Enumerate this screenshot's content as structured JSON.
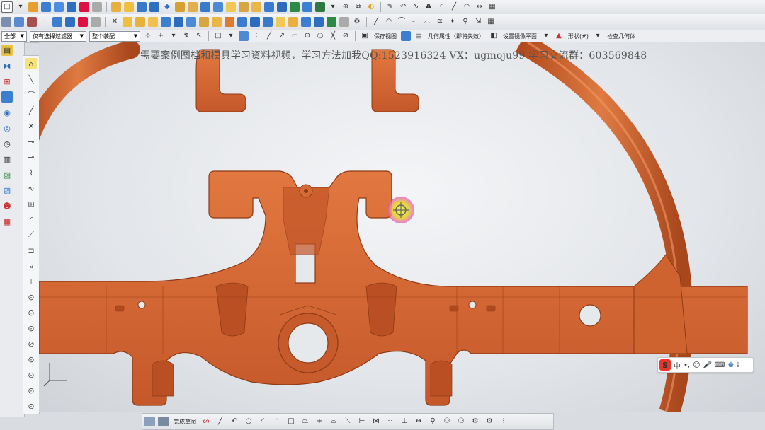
{
  "toolbar": {
    "row1_icons": [
      "new-file-icon",
      "shield-icon",
      "cube-icon",
      "box-icon",
      "document-icon",
      "cylinder-icon",
      "cone-icon",
      "surface-icon",
      "blend-icon",
      "sweep-icon",
      "trim-icon",
      "mesh-icon",
      "dimension-icon",
      "sheet-icon",
      "view-icon",
      "layer-icon",
      "palette-icon",
      "camera-icon",
      "arrow-icon",
      "ruler-icon",
      "spline-icon",
      "curve-icon",
      "undo-icon",
      "settings-icon"
    ],
    "row3": {
      "filter_combo": "全部",
      "selection_scope_combo": "仅有选择过滤器",
      "assembly_combo": "整个装配",
      "save_view_label": "保存视图",
      "geometry_props_label": "几何属性（即将失效）",
      "mirror_plane_label": "设置镜像平面",
      "shape_label": "形状(#)",
      "check_geometry_label": "检查几何体"
    }
  },
  "watermark": {
    "text": "需要案例图档和模具学习资料视频，学习方法加我QQ:1523916324  VX：ugmoju99 学习交流群：603569848"
  },
  "bottom_bar": {
    "finish_sketch_label": "完成草图"
  },
  "ime": {
    "logo": "S",
    "lang": "中"
  },
  "colors": {
    "part_orange": "#d4622e",
    "part_shadow": "#a8461c",
    "part_highlight": "#ec8a55",
    "viewport_bg": "#e6e9ec"
  }
}
